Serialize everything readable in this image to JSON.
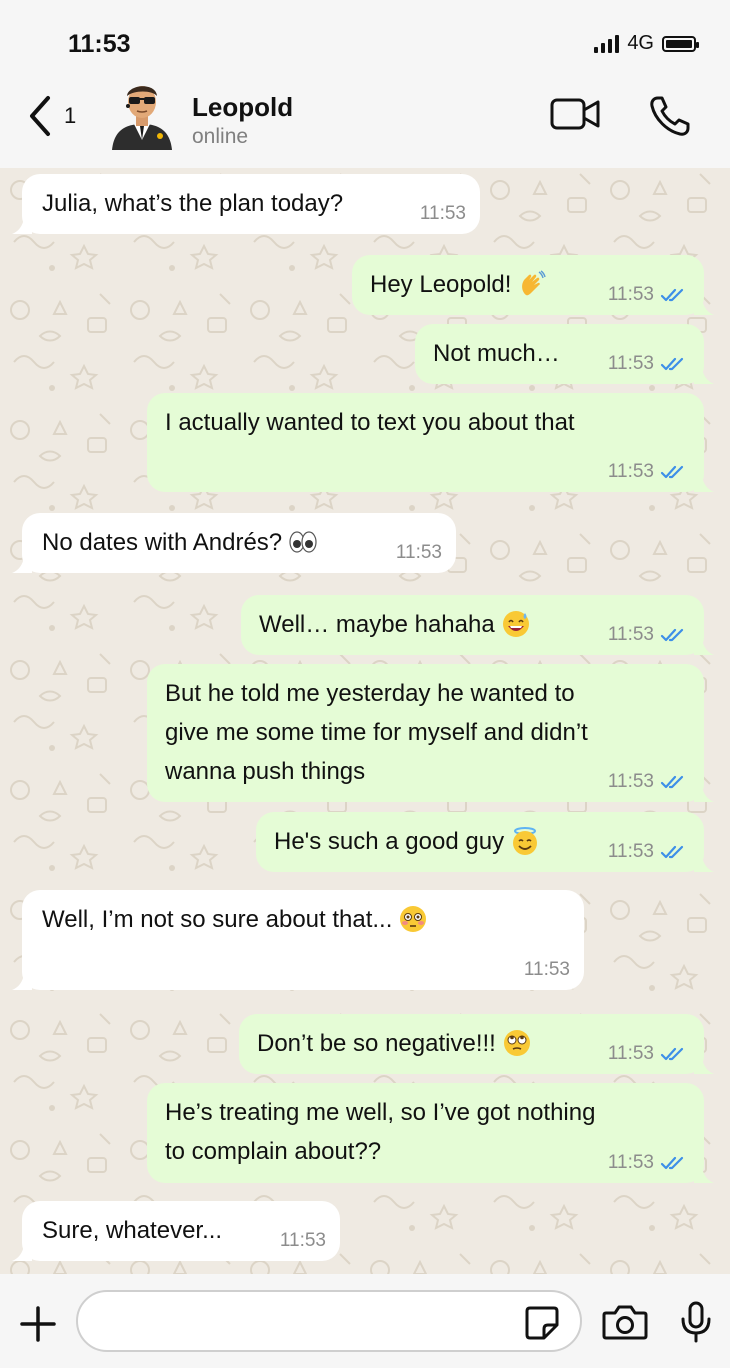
{
  "status": {
    "time": "11:53",
    "network": "4G"
  },
  "header": {
    "back_count": "1",
    "name": "Leopold",
    "status": "online"
  },
  "messages": [
    {
      "dir": "in",
      "text": "Julia, what’s the plan today?",
      "time": "11:53",
      "emoji": ""
    },
    {
      "dir": "out",
      "text": "Hey Leopold!",
      "time": "11:53",
      "emoji": "waving-hand",
      "read": true
    },
    {
      "dir": "out",
      "text": "Not much…",
      "time": "11:53",
      "emoji": "",
      "read": true
    },
    {
      "dir": "out",
      "text": "I actually wanted to text you about that",
      "time": "11:53",
      "emoji": "",
      "read": true
    },
    {
      "dir": "in",
      "text": "No dates with Andrés?",
      "time": "11:53",
      "emoji": "eyes"
    },
    {
      "dir": "out",
      "text": "Well… maybe hahaha",
      "time": "11:53",
      "emoji": "grinning-sweat",
      "read": true
    },
    {
      "dir": "out",
      "text": "But he told me yesterday he wanted to\ngive me some time for myself and didn’t\nwanna push things",
      "time": "11:53",
      "emoji": "",
      "read": true
    },
    {
      "dir": "out",
      "text": "He's such a good guy",
      "time": "11:53",
      "emoji": "smiling-halo",
      "read": true
    },
    {
      "dir": "in",
      "text": "Well, I’m not so sure about that...",
      "time": "11:53",
      "emoji": "flushed-face"
    },
    {
      "dir": "out",
      "text": "Don’t be so negative!!!",
      "time": "11:53",
      "emoji": "eye-roll",
      "read": true
    },
    {
      "dir": "out",
      "text": "He’s treating me well, so I’ve got nothing\nto complain about??",
      "time": "11:53",
      "emoji": "",
      "read": true
    },
    {
      "dir": "in",
      "text": "Sure, whatever...",
      "time": "11:53",
      "emoji": ""
    }
  ],
  "composer": {
    "value": "",
    "placeholder": ""
  },
  "colors": {
    "incoming": "#ffffff",
    "outgoing": "#e5fcd6",
    "read_ticks": "#3d8fe8",
    "wallpaper": "#efeae2"
  },
  "icons": [
    "back-chevron-icon",
    "video-call-icon",
    "phone-call-icon",
    "plus-icon",
    "sticker-icon",
    "camera-icon",
    "microphone-icon"
  ]
}
